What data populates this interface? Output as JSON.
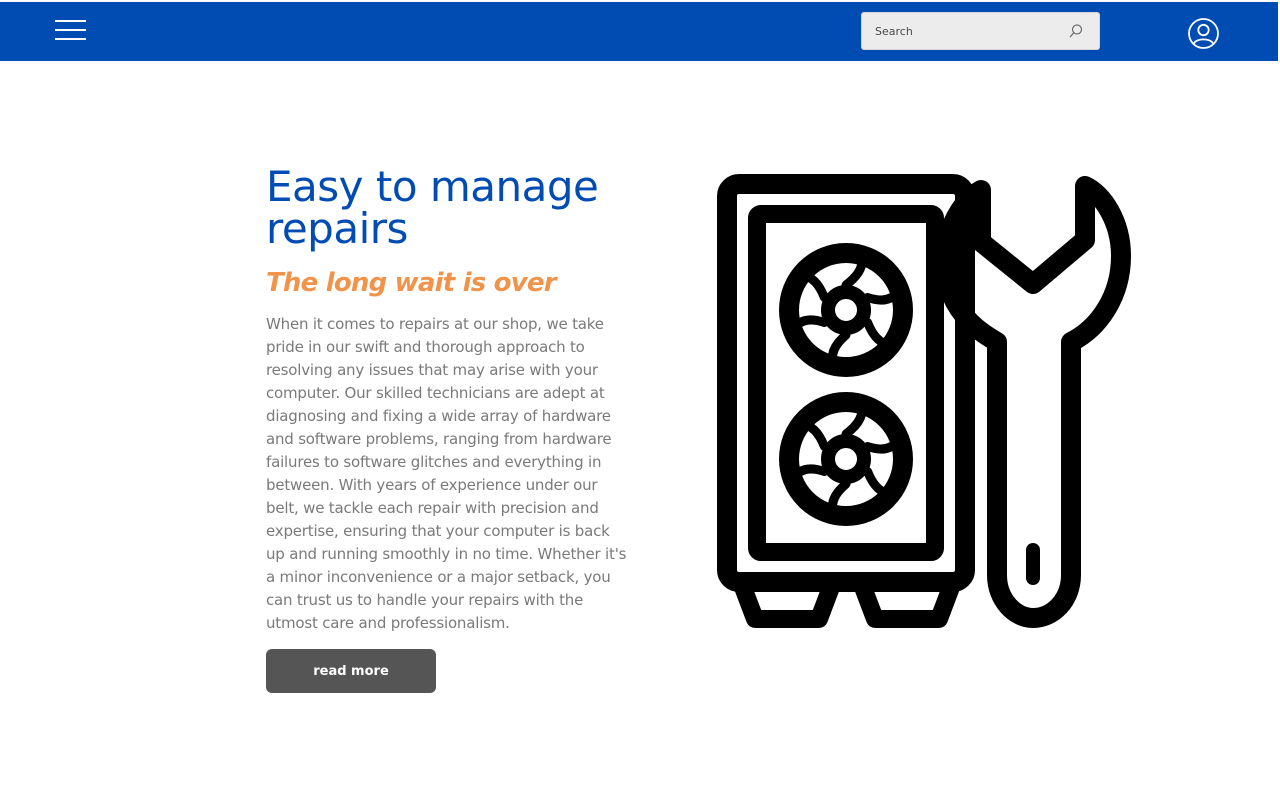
{
  "header": {
    "background": "#004cb3",
    "menu_icon": "hamburger-menu-icon",
    "search": {
      "placeholder": "Search",
      "icon": "search-icon"
    },
    "account_icon": "user-circle-icon"
  },
  "hero": {
    "title": "Easy to manage repairs",
    "subtitle": "The long wait is over",
    "body": "When it comes to repairs at our shop, we take pride in our swift and thorough approach to resolving any issues that may arise with your computer. Our skilled technicians are adept at diagnosing and fixing a wide array of hardware and software problems, ranging from hardware failures to software glitches and everything in between. With years of experience under our belt, we tackle each repair with precision and expertise, ensuring that your computer is back up and running smoothly in no time. Whether it's a minor inconvenience or a major setback, you can trust us to handle your repairs with the utmost care and professionalism.",
    "cta_label": "read more",
    "illustration": "pc-tower-with-wrench-icon"
  },
  "colors": {
    "primary": "#004cb3",
    "accent": "#f0944c",
    "body_text": "#7a7a7a",
    "button": "#555555"
  }
}
